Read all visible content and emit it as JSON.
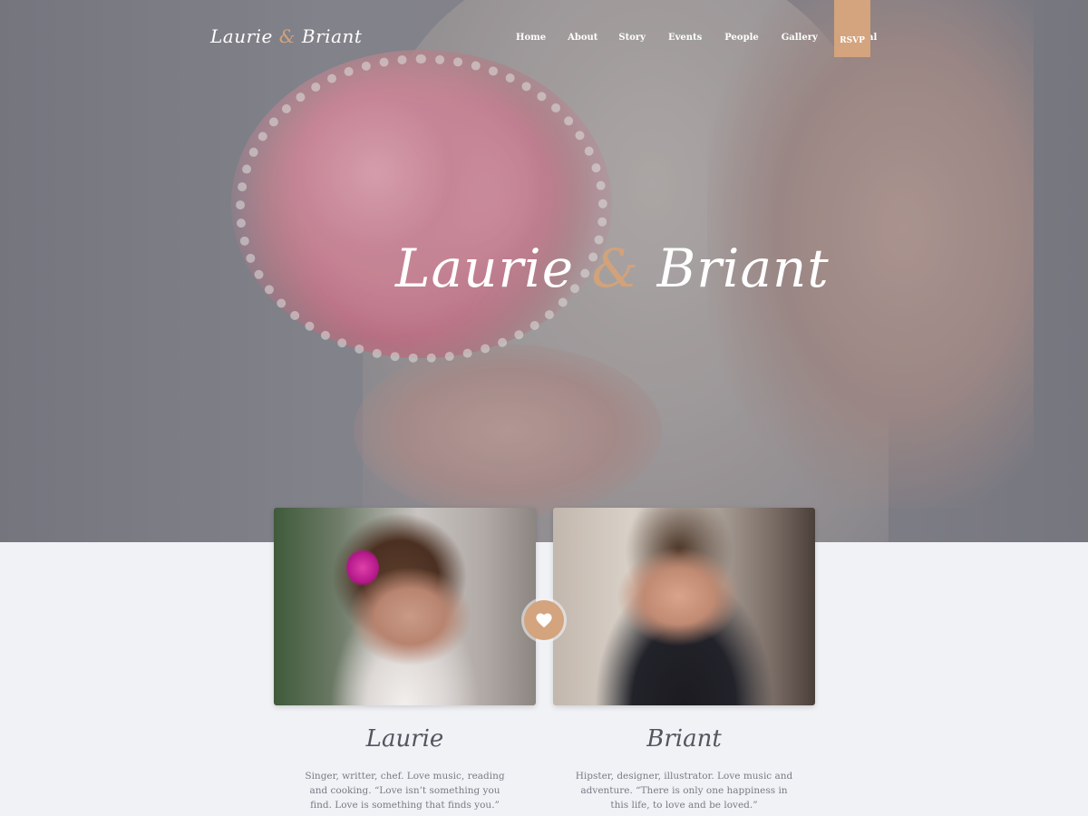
{
  "site": {
    "logo_first": "Laurie",
    "logo_amp": "&",
    "logo_second": "Briant"
  },
  "nav": {
    "items": [
      "Home",
      "About",
      "Story",
      "Events",
      "People",
      "Gallery",
      "Journal"
    ],
    "rsvp": "RSVP"
  },
  "hero": {
    "title_first": "Laurie",
    "title_amp": "&",
    "title_second": "Briant"
  },
  "couple": {
    "bride": {
      "name": "Laurie",
      "bio": "Singer, writter, chef. Love music, reading and cooking. “Love isn’t something you find. Love is something that finds you.”"
    },
    "groom": {
      "name": "Briant",
      "bio": "Hipster, designer, illustrator. Love music and adventure. “There is only one happiness in this life, to love and be loved.”"
    },
    "badge_icon": "heart-icon"
  },
  "colors": {
    "accent": "#d3a47d",
    "background": "#f1f2f6",
    "text": "#7a7a85"
  }
}
